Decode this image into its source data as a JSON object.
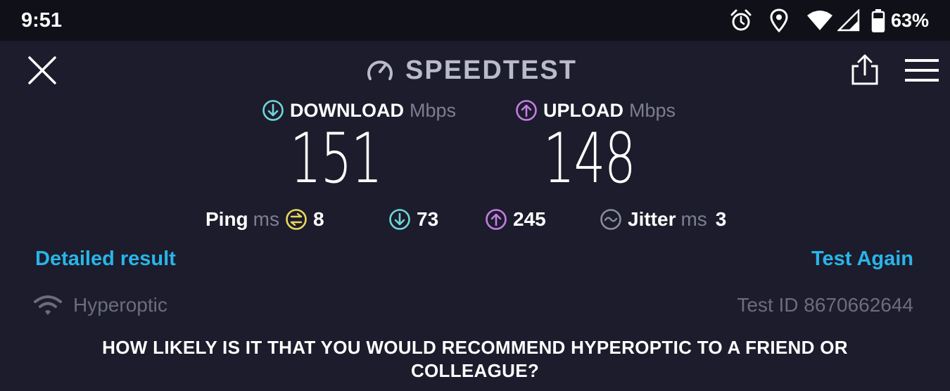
{
  "status_bar": {
    "time": "9:51",
    "battery_percent": "63%"
  },
  "header": {
    "title": "SPEEDTEST"
  },
  "download": {
    "label": "DOWNLOAD",
    "unit": "Mbps",
    "value": "151",
    "color": "#6fd6d6"
  },
  "upload": {
    "label": "UPLOAD",
    "unit": "Mbps",
    "value": "148",
    "color": "#c47ee0"
  },
  "stats": {
    "ping_label": "Ping",
    "ping_unit": "ms",
    "ping_value": "8",
    "ping_color": "#e8d85a",
    "download_latency": "73",
    "upload_latency": "245",
    "jitter_label": "Jitter",
    "jitter_unit": "ms",
    "jitter_value": "3"
  },
  "actions": {
    "detailed_result": "Detailed result",
    "test_again": "Test Again",
    "link_color": "#29b5e8"
  },
  "connection": {
    "provider": "Hyperoptic",
    "test_id": "Test ID 8670662644"
  },
  "survey": {
    "question": "HOW LIKELY IS IT THAT YOU WOULD RECOMMEND HYPEROPTIC TO A FRIEND OR COLLEAGUE?"
  },
  "icons": {
    "status": [
      "alarm-icon",
      "location-pin-icon",
      "wifi-icon",
      "cell-signal-icon",
      "battery-icon"
    ],
    "header": [
      "close-icon",
      "speedometer-icon",
      "share-icon",
      "hamburger-menu-icon"
    ]
  }
}
